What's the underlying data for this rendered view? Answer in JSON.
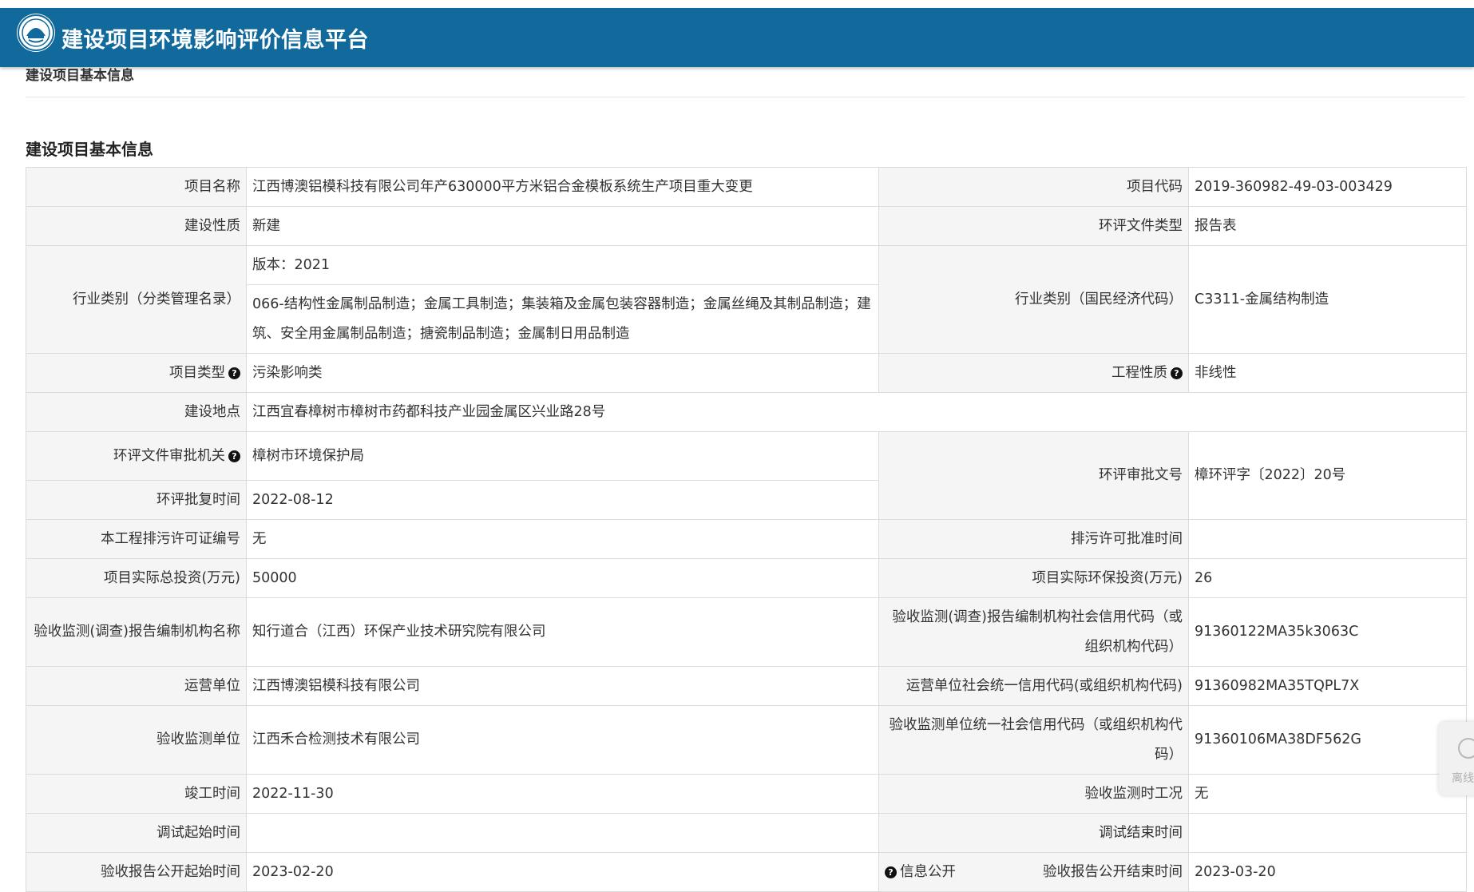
{
  "header": {
    "site_title": "建设项目环境影响评价信息平台",
    "logo_icon": "environmental-emblem-logo",
    "bar_color": "#126a9c"
  },
  "breadcrumb": "建设项目基本信息",
  "section_title": "建设项目基本信息",
  "rows": {
    "project_name": {
      "label": "项目名称",
      "value": "江西博澳铝模科技有限公司年产630000平方米铝合金模板系统生产项目重大变更"
    },
    "project_code": {
      "label": "项目代码",
      "value": "2019-360982-49-03-003429"
    },
    "construction_nature": {
      "label": "建设性质",
      "value": "新建"
    },
    "eia_doc_type": {
      "label": "环评文件类型",
      "value": "报告表"
    },
    "industry_mgmt": {
      "label": "行业类别（分类管理名录）",
      "version": "版本：2021",
      "value": "066-结构性金属制品制造；金属工具制造；集装箱及金属包装容器制造；金属丝绳及其制品制造；建筑、安全用金属制品制造；搪瓷制品制造；金属制日用品制造"
    },
    "industry_national": {
      "label": "行业类别（国民经济代码）",
      "value": "C3311-金属结构制造"
    },
    "project_type": {
      "label": "项目类型",
      "value": "污染影响类"
    },
    "engineering_nature": {
      "label": "工程性质",
      "value": "非线性"
    },
    "location": {
      "label": "建设地点",
      "value": "江西宜春樟树市樟树市药都科技产业园金属区兴业路28号"
    },
    "approval_authority": {
      "label": "环评文件审批机关",
      "value": "樟树市环境保护局"
    },
    "approval_doc_no": {
      "label": "环评审批文号",
      "value": "樟环评字〔2022〕20号"
    },
    "approval_date": {
      "label": "环评批复时间",
      "value": "2022-08-12"
    },
    "discharge_permit_no": {
      "label": "本工程排污许可证编号",
      "value": "无"
    },
    "discharge_permit_date": {
      "label": "排污许可批准时间",
      "value": ""
    },
    "total_investment": {
      "label": "项目实际总投资(万元)",
      "value": "50000"
    },
    "env_investment": {
      "label": "项目实际环保投资(万元)",
      "value": "26"
    },
    "report_org_name": {
      "label": "验收监测(调查)报告编制机构名称",
      "value": "知行道合（江西）环保产业技术研究院有限公司"
    },
    "report_org_code": {
      "label": "验收监测(调查)报告编制机构社会信用代码（或组织机构代码）",
      "value": "91360122MA35k3063C"
    },
    "operator": {
      "label": "运营单位",
      "value": "江西博澳铝模科技有限公司"
    },
    "operator_code": {
      "label": "运营单位社会统一信用代码(或组织机构代码)",
      "value": "91360982MA35TQPL7X"
    },
    "monitor_unit": {
      "label": "验收监测单位",
      "value": "江西禾合检测技术有限公司"
    },
    "monitor_unit_code": {
      "label": "验收监测单位统一社会信用代码（或组织机构代码）",
      "value": "91360106MA38DF562G"
    },
    "completion_date": {
      "label": "竣工时间",
      "value": "2022-11-30"
    },
    "monitor_condition": {
      "label": "验收监测时工况",
      "value": "无"
    },
    "debug_start": {
      "label": "调试起始时间",
      "value": ""
    },
    "debug_end": {
      "label": "调试结束时间",
      "value": ""
    },
    "publish_start": {
      "label": "验收报告公开起始时间",
      "value": "2023-02-20"
    },
    "info_public": {
      "label": "信息公开"
    },
    "publish_end": {
      "label": "验收报告公开结束时间",
      "value": "2023-03-20"
    }
  },
  "float_widget": {
    "label": "离线",
    "icon": "chat-bubble-icon"
  }
}
